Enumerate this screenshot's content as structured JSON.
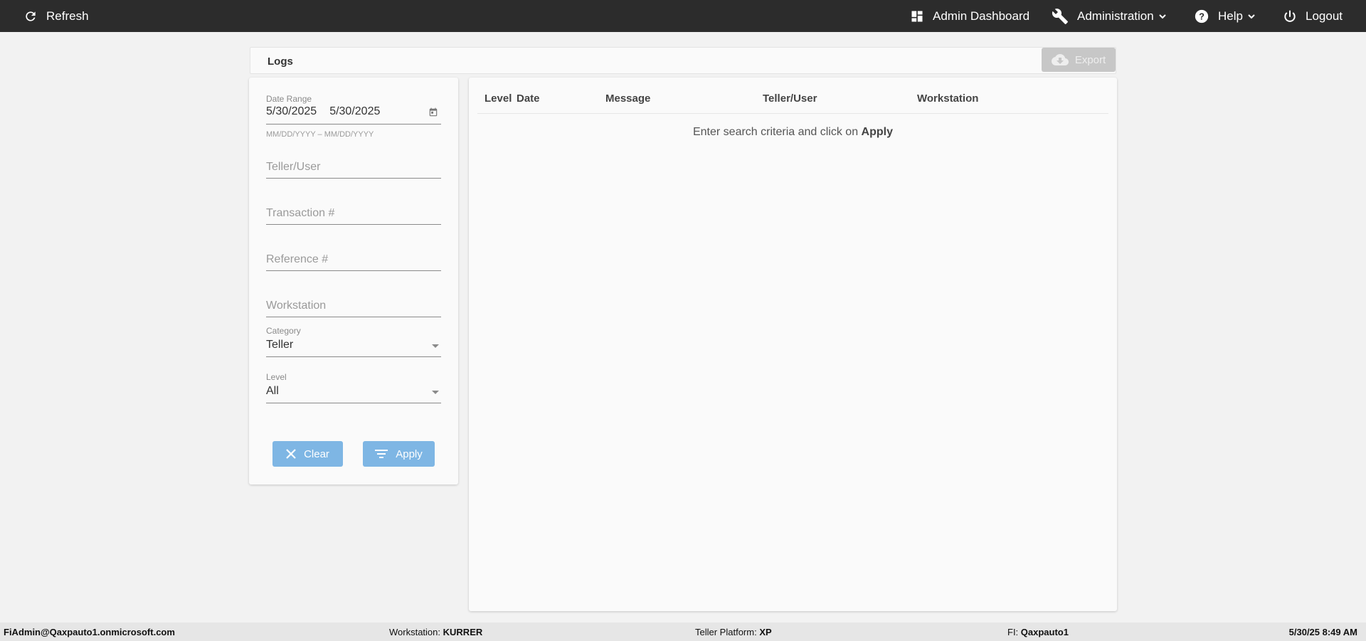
{
  "topbar": {
    "refresh_label": "Refresh",
    "admin_dashboard_label": "Admin Dashboard",
    "administration_label": "Administration",
    "help_label": "Help",
    "logout_label": "Logout",
    "background_color": "#2c2c2c"
  },
  "logs": {
    "title": "Logs",
    "export_label": "Export"
  },
  "filters": {
    "date_range_label": "Date Range",
    "date_from": "5/30/2025",
    "date_to": "5/30/2025",
    "date_hint": "MM/DD/YYYY – MM/DD/YYYY",
    "teller_user_placeholder": "Teller/User",
    "transaction_placeholder": "Transaction #",
    "reference_placeholder": "Reference #",
    "workstation_placeholder": "Workstation",
    "category_label": "Category",
    "category_value": "Teller",
    "level_label": "Level",
    "level_value": "All",
    "clear_label": "Clear",
    "apply_label": "Apply",
    "button_color": "#7eb6e4"
  },
  "results": {
    "columns": [
      "Level",
      "Date",
      "Message",
      "Teller/User",
      "Workstation"
    ],
    "empty_text": "Enter search criteria and click on",
    "empty_action": "Apply"
  },
  "statusbar": {
    "user": "FiAdmin@Qaxpauto1.onmicrosoft.com",
    "workstation_label": "Workstation:",
    "workstation_value": "KURRER",
    "platform_label": "Teller Platform:",
    "platform_value": "XP",
    "fi_label": "FI:",
    "fi_value": "Qaxpauto1",
    "datetime": "5/30/25 8:49 AM"
  }
}
